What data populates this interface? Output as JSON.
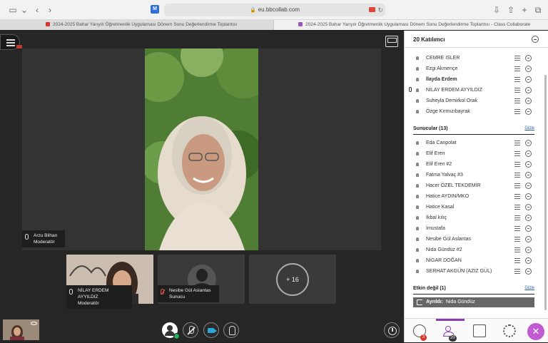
{
  "browser": {
    "url": "eu.bbcollab.com",
    "tabs": [
      {
        "title": "2024-2025 Bahar Yarıyılı Öğretmenlik Uygulaması Dönem Sonu Değerlendirme Toplantısı",
        "color": "#d9342b"
      },
      {
        "title": "2024-2025 Bahar Yarıyılı Öğretmenlik Uygulaması Dönem Sonu Değerlendirme Toplantısı - Class Collaborate",
        "color": "#9b59b6"
      }
    ]
  },
  "stage": {
    "main_speaker": {
      "name": "Arzu Bilhan",
      "role": "Moderatör"
    },
    "tiles": [
      {
        "name": "NİLAY ERDEM AYYILDIZ",
        "role": "Moderatör"
      },
      {
        "name": "Nesibe Gül Aslantas",
        "role": "Sunucu"
      },
      {
        "more": "+ 16"
      }
    ]
  },
  "panel": {
    "title": "20 Katılımcı",
    "top_rows": [
      {
        "name": "CEMRE ISLER",
        "bold": false
      },
      {
        "name": "Ezgi Akmençe",
        "bold": false
      },
      {
        "name": "İlayda Erdem",
        "bold": true
      },
      {
        "name": "NİLAY ERDEM AYYILDIZ",
        "bold": false
      },
      {
        "name": "Suheyla Demirkol Orak",
        "bold": false
      },
      {
        "name": "Özge Kırmızıbayrak",
        "bold": false
      }
    ],
    "presenters": {
      "header": "Sunucular (13)",
      "hide": "Gizle",
      "rows": [
        "Eda Canpolat",
        "Elif Eren",
        "Elif Eren #2",
        "Fatma Yalvaç #3",
        "Hacer ÖZEL TEKDEMİR",
        "Hatice AYDIN/MKO",
        "Hatice Kasal",
        "İkbal kılıç",
        "İmustafa",
        "Nesibe Gül Aslantas",
        "Nida Gündüz #2",
        "NİGAR DOĞAN",
        "SERHAT AKGÜN (AZİZ GÜL)"
      ]
    },
    "inactive": {
      "header": "Etkin değil (1)",
      "hide": "Gizle",
      "status": "Ayrıldı:",
      "name": "Nida Gündüz"
    },
    "badges": {
      "chat": "3",
      "participants": "20"
    }
  },
  "colors": {
    "accent": "#8a3fb0",
    "alert": "#d9342b",
    "link": "#2a5db0"
  }
}
